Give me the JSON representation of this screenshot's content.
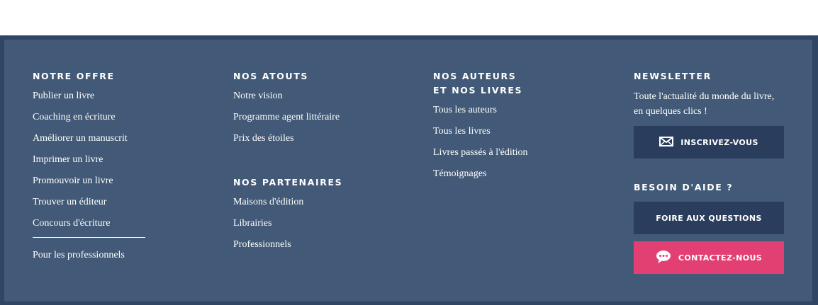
{
  "columns": {
    "offre": {
      "heading": "NOTRE OFFRE",
      "links": [
        "Publier un livre",
        "Coaching en écriture",
        "Améliorer un manuscrit",
        "Imprimer un livre",
        "Promouvoir un livre",
        "Trouver un éditeur",
        "Concours d'écriture"
      ],
      "pro_link": "Pour les professionnels"
    },
    "atouts": {
      "heading": "NOS ATOUTS",
      "links": [
        "Notre vision",
        "Programme agent littéraire",
        "Prix des étoiles"
      ],
      "partners_heading": "NOS PARTENAIRES",
      "partners_links": [
        "Maisons d'édition",
        "Librairies",
        "Professionnels"
      ]
    },
    "auteurs": {
      "heading_line1": "NOS AUTEURS",
      "heading_line2": "ET NOS LIVRES",
      "links": [
        "Tous les auteurs",
        "Tous les livres",
        "Livres passés à l'édition",
        "Témoignages"
      ]
    },
    "newsletter": {
      "heading": "NEWSLETTER",
      "description": "Toute l'actualité du monde du livre, en quelques clics !",
      "subscribe_label": "INSCRIVEZ-VOUS",
      "help_heading": "BESOIN D'AIDE ?",
      "faq_label": "FOIRE AUX QUESTIONS",
      "contact_label": "CONTACTEZ-NOUS"
    }
  },
  "colors": {
    "frame": "#2e4564",
    "panel": "#425a77",
    "button_dark": "#2a3d5c",
    "button_pink": "#e23f73"
  },
  "icons": [
    "envelope-icon",
    "chat-bubble-icon"
  ]
}
